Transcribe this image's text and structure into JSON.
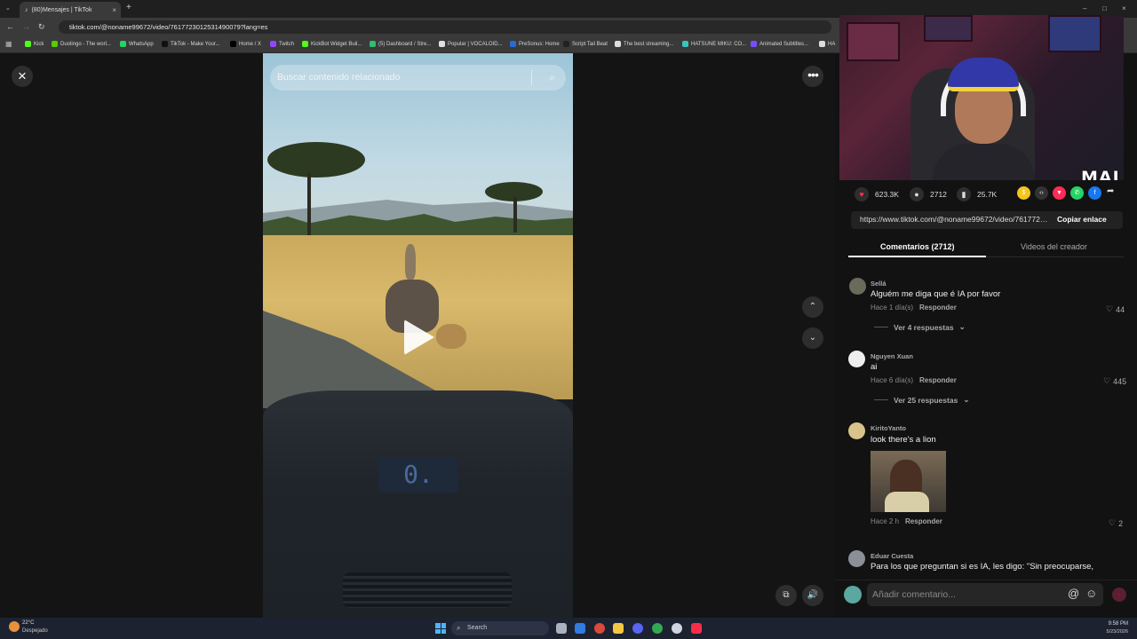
{
  "browser": {
    "tab_title": "(80)Mensajes | TikTok",
    "url": "tiktok.com/@noname99672/video/7617723012531490079?lang=es",
    "window_controls": [
      "–",
      "□",
      "×"
    ],
    "bookmarks": [
      {
        "label": "Kick",
        "color": "#53fc18"
      },
      {
        "label": "Duolingo - The worl...",
        "color": "#58cc02"
      },
      {
        "label": "WhatsApp",
        "color": "#25d366"
      },
      {
        "label": "TikTok - Make Your...",
        "color": "#111111"
      },
      {
        "label": "Home / X",
        "color": "#000000"
      },
      {
        "label": "Twitch",
        "color": "#9146ff"
      },
      {
        "label": "KickBot Widget Buil...",
        "color": "#53fc18"
      },
      {
        "label": "(5) Dashboard / Stre...",
        "color": "#2fbf71"
      },
      {
        "label": "Popular | VOCALOID...",
        "color": "#e0e0e0"
      },
      {
        "label": "PreSonus: Home",
        "color": "#2a6cd6"
      },
      {
        "label": "Script Tail Beat",
        "color": "#222222"
      },
      {
        "label": "The best streaming...",
        "color": "#dddddd"
      },
      {
        "label": "HATSUNE MIKU: CO...",
        "color": "#39c5bb"
      },
      {
        "label": "Animated Subtitles...",
        "color": "#7b4dff"
      },
      {
        "label": "HA",
        "color": "#dddddd"
      }
    ]
  },
  "video": {
    "search_placeholder": "Buscar contenido relacionado",
    "dash_display": "0."
  },
  "webcam": {
    "overlay_logo": "MAI"
  },
  "stats": {
    "likes": "623.3K",
    "comments": "2712",
    "saves": "25.7K"
  },
  "share": {
    "link": "https://www.tiktok.com/@noname99672/video/7617723012531490079",
    "copy_label": "Copiar enlace",
    "icons": [
      {
        "name": "coin-share",
        "color": "#f5c518"
      },
      {
        "name": "embed",
        "color": "#333333"
      },
      {
        "name": "send-to-friends",
        "color": "#fe2c55"
      },
      {
        "name": "whatsapp",
        "color": "#25d366"
      },
      {
        "name": "facebook",
        "color": "#1877f2"
      }
    ]
  },
  "tabs": {
    "comments": "Comentarios (2712)",
    "creator_videos": "Videos del creador"
  },
  "comments": [
    {
      "user": "Sellá",
      "text": "Alguém me diga que é IA por favor",
      "time": "Hace 1 día(s)",
      "reply": "Responder",
      "likes": "44",
      "replies": "Ver 4 respuestas",
      "avatar_color": "#6b6b5b"
    },
    {
      "user": "Nguyen Xuan",
      "text": "ai",
      "time": "Hace 6 día(s)",
      "reply": "Responder",
      "likes": "445",
      "replies": "Ver 25 respuestas",
      "avatar_color": "#eeeeee"
    },
    {
      "user": "KiritoYanto",
      "text": "look there's a lion",
      "time": "Hace 2 h",
      "reply": "Responder",
      "likes": "2",
      "avatar_color": "#d8c48a"
    },
    {
      "user": "Eduar Cuesta",
      "text": "Para los que preguntan si es IA, les digo: \"Sin preocuparse,",
      "avatar_color": "#8a8f98"
    }
  ],
  "composer": {
    "placeholder": "Añadir comentario..."
  },
  "taskbar": {
    "temperature": "22°C",
    "weather": "Despejado",
    "search": "Search",
    "time": "9:58 PM",
    "date": "5/23/2026"
  },
  "colors": {
    "accent": "#fe2c55",
    "background": "#121212"
  }
}
